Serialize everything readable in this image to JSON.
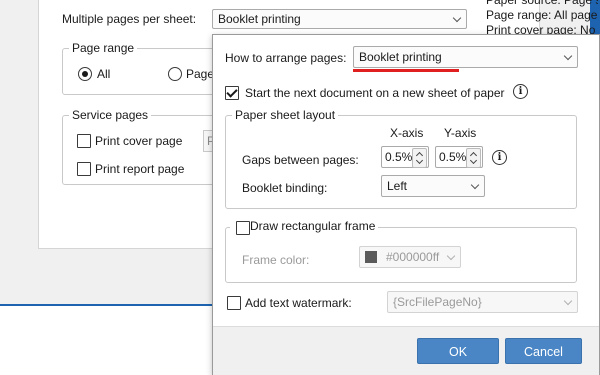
{
  "background": {
    "multiple_pages_label": "Multiple pages per sheet:",
    "multiple_pages_value": "Booklet printing",
    "summary_lines": [
      "Paper source: Page size",
      "Page range: All pages",
      "Print cover page: No"
    ],
    "page_range": {
      "legend": "Page range",
      "options": [
        "All",
        "Page"
      ]
    },
    "service_pages": {
      "legend": "Service pages",
      "print_cover_label": "Print cover page",
      "print_report_label": "Print report page",
      "partial_field": "P"
    }
  },
  "popup": {
    "arrange_label": "How to arrange pages:",
    "arrange_value": "Booklet printing",
    "next_doc_label": "Start the next document on a new sheet of paper",
    "next_doc_checked": true,
    "layout": {
      "legend": "Paper sheet layout",
      "x_axis_label": "X-axis",
      "y_axis_label": "Y-axis",
      "gaps_label": "Gaps between pages:",
      "gap_x": "0.5%",
      "gap_y": "0.5%",
      "binding_label": "Booklet binding:",
      "binding_value": "Left"
    },
    "frame": {
      "label": "Draw rectangular frame",
      "checked": false,
      "color_label": "Frame color:",
      "color_value": "#000000ff",
      "swatch_color": "#5a5a5a"
    },
    "watermark": {
      "label": "Add text watermark:",
      "checked": false,
      "value": "{SrcFilePageNo}"
    },
    "ok_label": "OK",
    "cancel_label": "Cancel"
  },
  "colors": {
    "accent_button": "#4a86c5",
    "highlight_underline": "#e02020",
    "window_blue": "#1e63b0"
  }
}
